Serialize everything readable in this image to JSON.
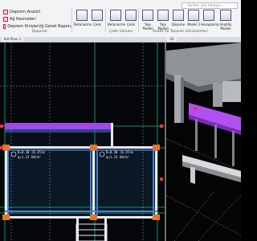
{
  "ribbon": {
    "search_placeholder": "Yardım için tıklayın...",
    "list_items": [
      {
        "label": "Deprem Analizi",
        "icon": "analysis-icon"
      },
      {
        "label": "Ağ Kesmeleri",
        "icon": "section-icon"
      },
      {
        "label": "Deprem Kirişleri/ğ Genel Raporu",
        "icon": "report-icon"
      }
    ],
    "buttons": [
      {
        "label": "Betonarme",
        "icon": "concrete-icon"
      },
      {
        "label": "Çelik",
        "icon": "steel-icon"
      },
      {
        "label": "Betonarme",
        "icon": "concrete-beam-icon"
      },
      {
        "label": "Çelik",
        "icon": "steel-beam-icon"
      },
      {
        "label": "Yapı Modeli",
        "icon": "structure-model-icon"
      },
      {
        "label": "Yapı Modeli",
        "icon": "structure-model-2-icon"
      },
      {
        "label": "Döşeme",
        "icon": "slab-icon"
      },
      {
        "label": "Model 3",
        "icon": "model-icon"
      },
      {
        "label": "Hesaplama",
        "icon": "calc-icon"
      },
      {
        "label": "Analitik Modeli",
        "icon": "analytic-model-icon"
      }
    ],
    "groups": [
      "Raporlar",
      "Çelik Uzmanı",
      "Analiz ve Tasarım Görünümleri"
    ]
  },
  "tabs": [
    "Kat Planı 1",
    "3D"
  ],
  "plan": {
    "annotations": [
      {
        "line1": "D=0.30 (0.35)m",
        "line2": "q=1.13 kN/m²"
      },
      {
        "line1": "D=0.30 (0.35)m",
        "line2": "q=1.13 kN/m²"
      }
    ]
  },
  "colors": {
    "beam": "#a347e8",
    "column": "#e8742b",
    "grid": "#16c16a",
    "slab_fill": "#0b1826",
    "wall_blue": "#4f76d8"
  }
}
